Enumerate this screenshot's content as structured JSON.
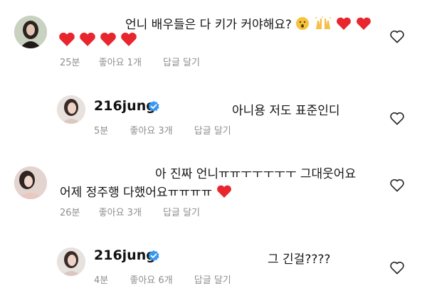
{
  "comments": [
    {
      "text": "언니 배우들은 다 키가 커야해요?",
      "text_line2": "",
      "time": "25분",
      "likes": "좋아요 1개",
      "reply": "답글 달기"
    },
    {
      "username": "216jung",
      "text": "아니용 저도 표준인디",
      "time": "5분",
      "likes": "좋아요 3개",
      "reply": "답글 달기"
    },
    {
      "text": "아 진짜 언니ㅠㅠㅜㅜㅜㅜㅜ 그대웃어요",
      "text_line2": "어제 정주행 다했어요ㅠㅠㅠㅠ",
      "time": "26분",
      "likes": "좋아요 3개",
      "reply": "답글 달기"
    },
    {
      "username": "216jung",
      "text": "그 긴걸????",
      "time": "4분",
      "likes": "좋아요 6개",
      "reply": "답글 달기"
    }
  ],
  "colors": {
    "heart_red": "#e8262e",
    "verified_blue": "#3897f0",
    "meta_gray": "#8e8e8e"
  },
  "icons": {
    "like": "heart-outline-icon",
    "verified": "verified-badge-icon",
    "emojis_c1": [
      "surprised-face-emoji",
      "raising-hands-emoji",
      "red-heart-emoji"
    ]
  }
}
